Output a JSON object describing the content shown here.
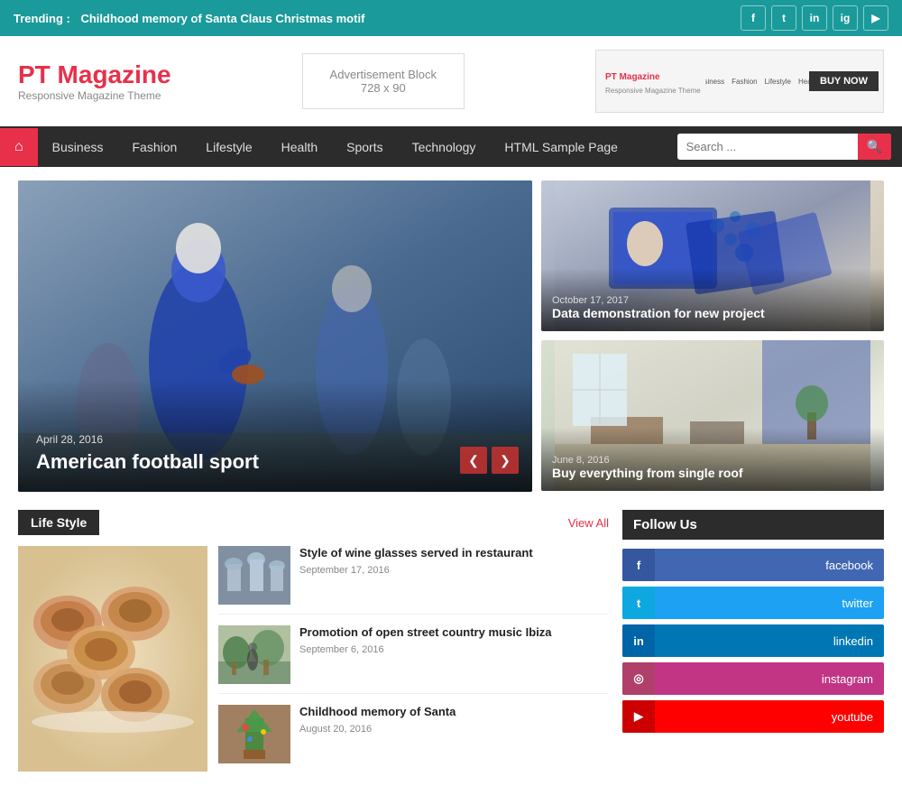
{
  "trending": {
    "label": "Trending :",
    "text": "Childhood memory of Santa Claus Christmas motif"
  },
  "social_top": [
    "f",
    "t",
    "in",
    "ig",
    "yt"
  ],
  "header": {
    "logo": "PT Magazine",
    "tagline": "Responsive Magazine Theme",
    "ad_line1": "Advertisement Block",
    "ad_line2": "728 x 90",
    "preview_logo": "PT Magazine",
    "preview_btn": "BUY NOW"
  },
  "nav": {
    "home_icon": "⌂",
    "links": [
      "Business",
      "Fashion",
      "Lifestyle",
      "Health",
      "Sports",
      "Technology",
      "HTML Sample Page"
    ],
    "search_placeholder": "Search ..."
  },
  "hero": {
    "main": {
      "date": "April 28, 2016",
      "title": "American football sport"
    },
    "card1": {
      "date": "October 17, 2017",
      "title": "Data demonstration for new project"
    },
    "card2": {
      "date": "June 8, 2016",
      "title": "Buy everything from single roof"
    },
    "prev": "❮",
    "next": "❯"
  },
  "lifestyle": {
    "section_title": "Life Style",
    "view_all": "View All",
    "articles": [
      {
        "title": "Style of wine glasses served in restaurant",
        "date": "September 17, 2016"
      },
      {
        "title": "Promotion of open street country music Ibiza",
        "date": "September 6, 2016"
      },
      {
        "title": "Childhood memory of Santa",
        "date": "August 20, 2016"
      }
    ]
  },
  "follow": {
    "title": "Follow Us",
    "platforms": [
      {
        "icon": "f",
        "name": "facebook",
        "class": "fb-btn"
      },
      {
        "icon": "t",
        "name": "twitter",
        "class": "tw-btn"
      },
      {
        "icon": "in",
        "name": "linkedin",
        "class": "li-btn"
      },
      {
        "icon": "ig",
        "name": "instagram",
        "class": "ig-btn"
      },
      {
        "icon": "▶",
        "name": "youtube",
        "class": "yt-btn"
      }
    ]
  }
}
